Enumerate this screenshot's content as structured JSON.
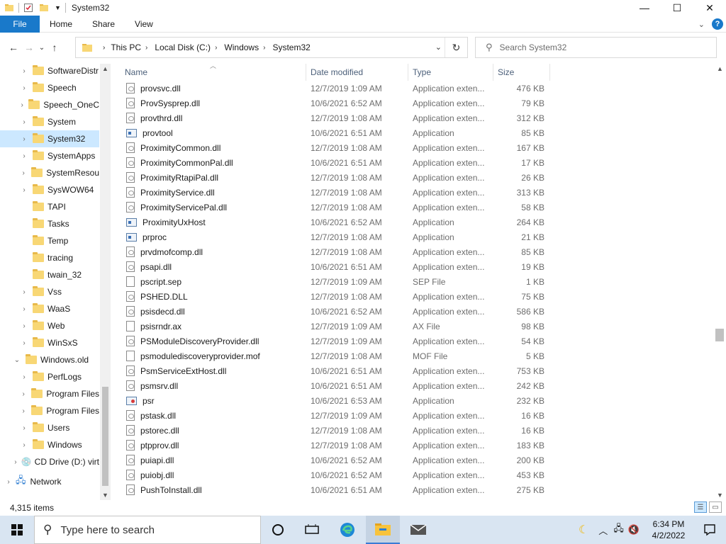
{
  "window": {
    "title": "System32",
    "controls": {
      "minimize": "—",
      "maximize": "☐",
      "close": "✕"
    }
  },
  "ribbon": {
    "file": "File",
    "tabs": [
      "Home",
      "Share",
      "View"
    ],
    "help": "?"
  },
  "address": {
    "crumbs": [
      "This PC",
      "Local Disk (C:)",
      "Windows",
      "System32"
    ],
    "search_placeholder": "Search System32"
  },
  "tree": {
    "items": [
      {
        "label": "SoftwareDistr",
        "expander": "›",
        "selected": false
      },
      {
        "label": "Speech",
        "expander": "›",
        "selected": false
      },
      {
        "label": "Speech_OneC",
        "expander": "›",
        "selected": false
      },
      {
        "label": "System",
        "expander": "›",
        "selected": false
      },
      {
        "label": "System32",
        "expander": "›",
        "selected": true
      },
      {
        "label": "SystemApps",
        "expander": "›",
        "selected": false
      },
      {
        "label": "SystemResou",
        "expander": "›",
        "selected": false
      },
      {
        "label": "SysWOW64",
        "expander": "›",
        "selected": false
      },
      {
        "label": "TAPI",
        "expander": "",
        "selected": false
      },
      {
        "label": "Tasks",
        "expander": "",
        "selected": false
      },
      {
        "label": "Temp",
        "expander": "",
        "selected": false
      },
      {
        "label": "tracing",
        "expander": "",
        "selected": false
      },
      {
        "label": "twain_32",
        "expander": "",
        "selected": false
      },
      {
        "label": "Vss",
        "expander": "›",
        "selected": false
      },
      {
        "label": "WaaS",
        "expander": "›",
        "selected": false
      },
      {
        "label": "Web",
        "expander": "›",
        "selected": false
      },
      {
        "label": "WinSxS",
        "expander": "›",
        "selected": false
      },
      {
        "label": "Windows.old",
        "expander": "⌄",
        "selected": false
      },
      {
        "label": "PerfLogs",
        "expander": "›",
        "selected": false
      },
      {
        "label": "Program Files",
        "expander": "›",
        "selected": false
      },
      {
        "label": "Program Files",
        "expander": "›",
        "selected": false
      },
      {
        "label": "Users",
        "expander": "›",
        "selected": false
      },
      {
        "label": "Windows",
        "expander": "›",
        "selected": false
      },
      {
        "label": "CD Drive (D:) virt",
        "expander": "›",
        "selected": false
      },
      {
        "label": "Network",
        "expander": "›",
        "selected": false
      }
    ]
  },
  "columns": {
    "name": "Name",
    "date": "Date modified",
    "type": "Type",
    "size": "Size"
  },
  "files": [
    {
      "name": "provsvc.dll",
      "date": "12/7/2019 1:09 AM",
      "type": "Application exten...",
      "size": "476 KB",
      "icon": "dll"
    },
    {
      "name": "ProvSysprep.dll",
      "date": "10/6/2021 6:52 AM",
      "type": "Application exten...",
      "size": "79 KB",
      "icon": "dll"
    },
    {
      "name": "provthrd.dll",
      "date": "12/7/2019 1:08 AM",
      "type": "Application exten...",
      "size": "312 KB",
      "icon": "dll"
    },
    {
      "name": "provtool",
      "date": "10/6/2021 6:51 AM",
      "type": "Application",
      "size": "85 KB",
      "icon": "app"
    },
    {
      "name": "ProximityCommon.dll",
      "date": "12/7/2019 1:08 AM",
      "type": "Application exten...",
      "size": "167 KB",
      "icon": "dll"
    },
    {
      "name": "ProximityCommonPal.dll",
      "date": "10/6/2021 6:51 AM",
      "type": "Application exten...",
      "size": "17 KB",
      "icon": "dll"
    },
    {
      "name": "ProximityRtapiPal.dll",
      "date": "12/7/2019 1:08 AM",
      "type": "Application exten...",
      "size": "26 KB",
      "icon": "dll"
    },
    {
      "name": "ProximityService.dll",
      "date": "12/7/2019 1:08 AM",
      "type": "Application exten...",
      "size": "313 KB",
      "icon": "dll"
    },
    {
      "name": "ProximityServicePal.dll",
      "date": "12/7/2019 1:08 AM",
      "type": "Application exten...",
      "size": "58 KB",
      "icon": "dll"
    },
    {
      "name": "ProximityUxHost",
      "date": "10/6/2021 6:52 AM",
      "type": "Application",
      "size": "264 KB",
      "icon": "app"
    },
    {
      "name": "prproc",
      "date": "12/7/2019 1:08 AM",
      "type": "Application",
      "size": "21 KB",
      "icon": "app"
    },
    {
      "name": "prvdmofcomp.dll",
      "date": "12/7/2019 1:08 AM",
      "type": "Application exten...",
      "size": "85 KB",
      "icon": "dll"
    },
    {
      "name": "psapi.dll",
      "date": "10/6/2021 6:51 AM",
      "type": "Application exten...",
      "size": "19 KB",
      "icon": "dll"
    },
    {
      "name": "pscript.sep",
      "date": "12/7/2019 1:09 AM",
      "type": "SEP File",
      "size": "1 KB",
      "icon": "file"
    },
    {
      "name": "PSHED.DLL",
      "date": "12/7/2019 1:08 AM",
      "type": "Application exten...",
      "size": "75 KB",
      "icon": "dll"
    },
    {
      "name": "psisdecd.dll",
      "date": "10/6/2021 6:52 AM",
      "type": "Application exten...",
      "size": "586 KB",
      "icon": "dll"
    },
    {
      "name": "psisrndr.ax",
      "date": "12/7/2019 1:09 AM",
      "type": "AX File",
      "size": "98 KB",
      "icon": "file"
    },
    {
      "name": "PSModuleDiscoveryProvider.dll",
      "date": "12/7/2019 1:09 AM",
      "type": "Application exten...",
      "size": "54 KB",
      "icon": "dll"
    },
    {
      "name": "psmodulediscoveryprovider.mof",
      "date": "12/7/2019 1:08 AM",
      "type": "MOF File",
      "size": "5 KB",
      "icon": "file"
    },
    {
      "name": "PsmServiceExtHost.dll",
      "date": "10/6/2021 6:51 AM",
      "type": "Application exten...",
      "size": "753 KB",
      "icon": "dll"
    },
    {
      "name": "psmsrv.dll",
      "date": "10/6/2021 6:51 AM",
      "type": "Application exten...",
      "size": "242 KB",
      "icon": "dll"
    },
    {
      "name": "psr",
      "date": "10/6/2021 6:53 AM",
      "type": "Application",
      "size": "232 KB",
      "icon": "psr"
    },
    {
      "name": "pstask.dll",
      "date": "12/7/2019 1:09 AM",
      "type": "Application exten...",
      "size": "16 KB",
      "icon": "dll"
    },
    {
      "name": "pstorec.dll",
      "date": "12/7/2019 1:08 AM",
      "type": "Application exten...",
      "size": "16 KB",
      "icon": "dll"
    },
    {
      "name": "ptpprov.dll",
      "date": "12/7/2019 1:08 AM",
      "type": "Application exten...",
      "size": "183 KB",
      "icon": "dll"
    },
    {
      "name": "puiapi.dll",
      "date": "10/6/2021 6:52 AM",
      "type": "Application exten...",
      "size": "200 KB",
      "icon": "dll"
    },
    {
      "name": "puiobj.dll",
      "date": "10/6/2021 6:52 AM",
      "type": "Application exten...",
      "size": "453 KB",
      "icon": "dll"
    },
    {
      "name": "PushToInstall.dll",
      "date": "10/6/2021 6:51 AM",
      "type": "Application exten...",
      "size": "275 KB",
      "icon": "dll"
    }
  ],
  "status": {
    "item_count": "4,315 items"
  },
  "taskbar": {
    "search_placeholder": "Type here to search",
    "time": "6:34 PM",
    "date": "4/2/2022"
  },
  "colors": {
    "accent": "#1979ca",
    "selection": "#cce8ff",
    "taskbar": "#d9e5f2"
  }
}
